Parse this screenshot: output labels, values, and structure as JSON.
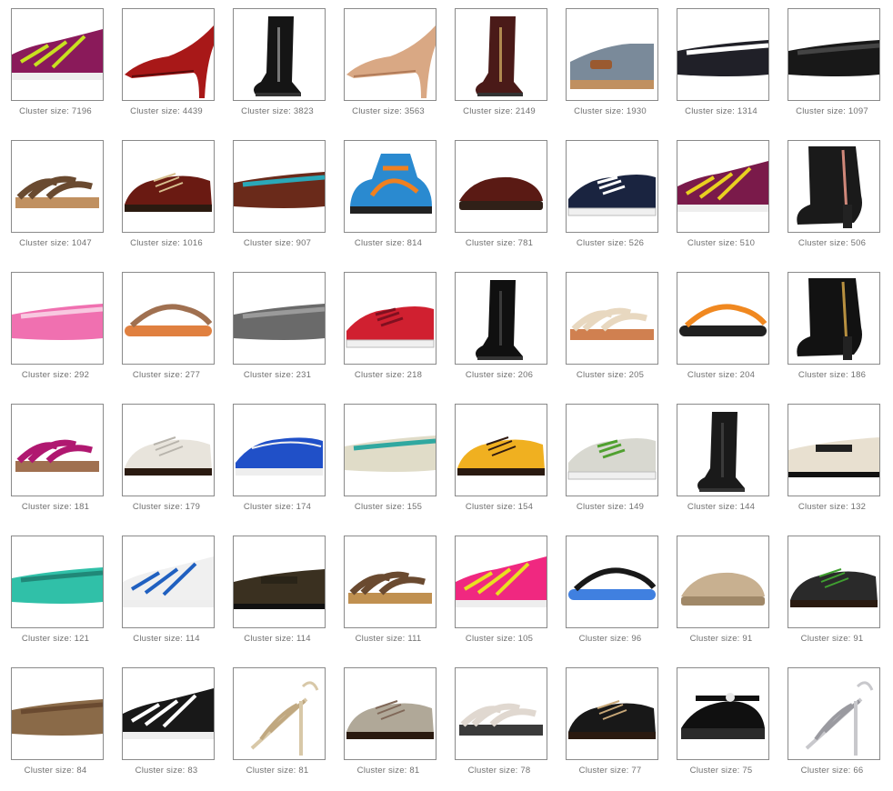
{
  "caption_prefix": "Cluster size: ",
  "items": [
    {
      "size": "7196",
      "shoe": "running-sneaker",
      "c1": "#8a1a5a",
      "c2": "#c8e020"
    },
    {
      "size": "4439",
      "shoe": "pump",
      "c1": "#a81818",
      "c2": "#5a0a0a"
    },
    {
      "size": "3823",
      "shoe": "tall-boot",
      "c1": "#151515",
      "c2": "#777777"
    },
    {
      "size": "3563",
      "shoe": "pump",
      "c1": "#d9a884",
      "c2": "#b07a58"
    },
    {
      "size": "2149",
      "shoe": "tall-boot",
      "c1": "#4a1a18",
      "c2": "#b08a50"
    },
    {
      "size": "1930",
      "shoe": "wedge",
      "c1": "#7a8a9a",
      "c2": "#c09060"
    },
    {
      "size": "1314",
      "shoe": "ballet-flat",
      "c1": "#202028",
      "c2": "#ffffff"
    },
    {
      "size": "1097",
      "shoe": "ballet-flat",
      "c1": "#181818",
      "c2": "#444444"
    },
    {
      "size": "1047",
      "shoe": "sandal",
      "c1": "#6a4a30",
      "c2": "#c09060"
    },
    {
      "size": "1016",
      "shoe": "oxford",
      "c1": "#6a1a12",
      "c2": "#d8c090"
    },
    {
      "size": "907",
      "shoe": "ballet-flat",
      "c1": "#6a2a1a",
      "c2": "#2aa8b8"
    },
    {
      "size": "814",
      "shoe": "hiker",
      "c1": "#2a8ad0",
      "c2": "#f08020"
    },
    {
      "size": "781",
      "shoe": "clog",
      "c1": "#5a1a14",
      "c2": "#302018"
    },
    {
      "size": "526",
      "shoe": "canvas-sneaker",
      "c1": "#1a2440",
      "c2": "#ffffff"
    },
    {
      "size": "510",
      "shoe": "running-sneaker",
      "c1": "#7a1a4a",
      "c2": "#e8d020"
    },
    {
      "size": "506",
      "shoe": "ankle-boot",
      "c1": "#1a1a1a",
      "c2": "#d0887a"
    },
    {
      "size": "292",
      "shoe": "ballet-flat",
      "c1": "#f070b0",
      "c2": "#f8c8e0"
    },
    {
      "size": "277",
      "shoe": "flip-flop",
      "c1": "#a07050",
      "c2": "#e08040"
    },
    {
      "size": "231",
      "shoe": "ballet-flat",
      "c1": "#6a6a6a",
      "c2": "#9a9a9a"
    },
    {
      "size": "218",
      "shoe": "canvas-sneaker",
      "c1": "#d02030",
      "c2": "#801020"
    },
    {
      "size": "206",
      "shoe": "tall-boot",
      "c1": "#101010",
      "c2": "#3a3a3a"
    },
    {
      "size": "205",
      "shoe": "sandal",
      "c1": "#e8d8c0",
      "c2": "#d08050"
    },
    {
      "size": "204",
      "shoe": "flip-flop",
      "c1": "#f08820",
      "c2": "#202020"
    },
    {
      "size": "186",
      "shoe": "ankle-boot",
      "c1": "#121212",
      "c2": "#b89040"
    },
    {
      "size": "181",
      "shoe": "sandal",
      "c1": "#b01870",
      "c2": "#a07050"
    },
    {
      "size": "179",
      "shoe": "oxford",
      "c1": "#e8e4dc",
      "c2": "#b8b4ac"
    },
    {
      "size": "174",
      "shoe": "boat-shoe",
      "c1": "#2050c8",
      "c2": "#f0f0f0"
    },
    {
      "size": "155",
      "shoe": "ballet-flat",
      "c1": "#e0dcc8",
      "c2": "#30a8a0"
    },
    {
      "size": "154",
      "shoe": "oxford",
      "c1": "#f0b020",
      "c2": "#301a10"
    },
    {
      "size": "149",
      "shoe": "canvas-sneaker",
      "c1": "#d8d8d0",
      "c2": "#50a030"
    },
    {
      "size": "144",
      "shoe": "tall-boot",
      "c1": "#1a1a1a",
      "c2": "#3a3a3a"
    },
    {
      "size": "132",
      "shoe": "loafer",
      "c1": "#e8e0d0",
      "c2": "#202020"
    },
    {
      "size": "121",
      "shoe": "ballet-flat",
      "c1": "#30c0a8",
      "c2": "#208878"
    },
    {
      "size": "114",
      "shoe": "running-sneaker",
      "c1": "#f0f0f0",
      "c2": "#2060c0"
    },
    {
      "size": "114",
      "shoe": "loafer",
      "c1": "#3a3020",
      "c2": "#2a2418"
    },
    {
      "size": "111",
      "shoe": "sandal",
      "c1": "#6a4a30",
      "c2": "#c09050"
    },
    {
      "size": "105",
      "shoe": "running-sneaker",
      "c1": "#f02880",
      "c2": "#e8e020"
    },
    {
      "size": "96",
      "shoe": "flip-flop",
      "c1": "#181818",
      "c2": "#4080e0"
    },
    {
      "size": "91",
      "shoe": "clog",
      "c1": "#c8b090",
      "c2": "#a08868"
    },
    {
      "size": "91",
      "shoe": "oxford",
      "c1": "#2a2a2a",
      "c2": "#40a030"
    },
    {
      "size": "84",
      "shoe": "ballet-flat",
      "c1": "#8a6a48",
      "c2": "#6a4a30"
    },
    {
      "size": "83",
      "shoe": "running-sneaker",
      "c1": "#181818",
      "c2": "#ffffff"
    },
    {
      "size": "81",
      "shoe": "stiletto-sandal",
      "c1": "#d8c8a8",
      "c2": "#c0a880"
    },
    {
      "size": "81",
      "shoe": "oxford",
      "c1": "#b0a898",
      "c2": "#806858"
    },
    {
      "size": "78",
      "shoe": "sandal",
      "c1": "#e0d8d0",
      "c2": "#3a3a3a"
    },
    {
      "size": "77",
      "shoe": "oxford",
      "c1": "#181818",
      "c2": "#c8a878"
    },
    {
      "size": "75",
      "shoe": "mary-jane",
      "c1": "#101010",
      "c2": "#e8e8e8"
    },
    {
      "size": "66",
      "shoe": "stiletto-sandal",
      "c1": "#c8c8cc",
      "c2": "#9a9aa0"
    }
  ]
}
